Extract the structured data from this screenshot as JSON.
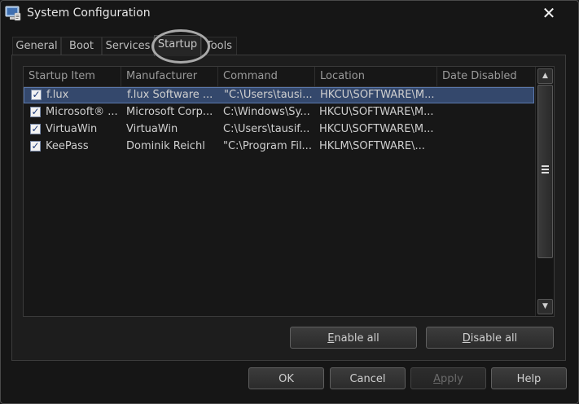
{
  "window": {
    "title": "System Configuration",
    "close_icon": "✕"
  },
  "tabs": [
    {
      "label": "General",
      "active": false
    },
    {
      "label": "Boot",
      "active": false
    },
    {
      "label": "Services",
      "active": false
    },
    {
      "label": "Startup",
      "active": true
    },
    {
      "label": "Tools",
      "active": false
    }
  ],
  "startup": {
    "columns": [
      "Startup Item",
      "Manufacturer",
      "Command",
      "Location",
      "Date Disabled"
    ],
    "rows": [
      {
        "checked": true,
        "selected": true,
        "item": "f.lux",
        "manufacturer": "f.lux Software ...",
        "command": "\"C:\\Users\\tausi...",
        "location": "HKCU\\SOFTWARE\\M...",
        "date_disabled": ""
      },
      {
        "checked": true,
        "selected": false,
        "item": "Microsoft® ...",
        "manufacturer": "Microsoft Corp...",
        "command": "C:\\Windows\\Sy...",
        "location": "HKCU\\SOFTWARE\\M...",
        "date_disabled": ""
      },
      {
        "checked": true,
        "selected": false,
        "item": "VirtuaWin",
        "manufacturer": "VirtuaWin",
        "command": "C:\\Users\\tausif...",
        "location": "HKCU\\SOFTWARE\\M...",
        "date_disabled": ""
      },
      {
        "checked": true,
        "selected": false,
        "item": "KeePass",
        "manufacturer": "Dominik Reichl",
        "command": "\"C:\\Program Fil...",
        "location": "HKLM\\SOFTWARE\\...",
        "date_disabled": ""
      }
    ],
    "enable_all": {
      "hotkey": "E",
      "rest": "nable all"
    },
    "disable_all": {
      "hotkey": "D",
      "rest": "isable all"
    }
  },
  "footer": {
    "ok": "OK",
    "cancel": "Cancel",
    "apply": {
      "hotkey": "A",
      "rest": "pply",
      "enabled": false
    },
    "help": "Help"
  },
  "colors": {
    "selection": "#34486c",
    "background": "#1b1b1b"
  }
}
